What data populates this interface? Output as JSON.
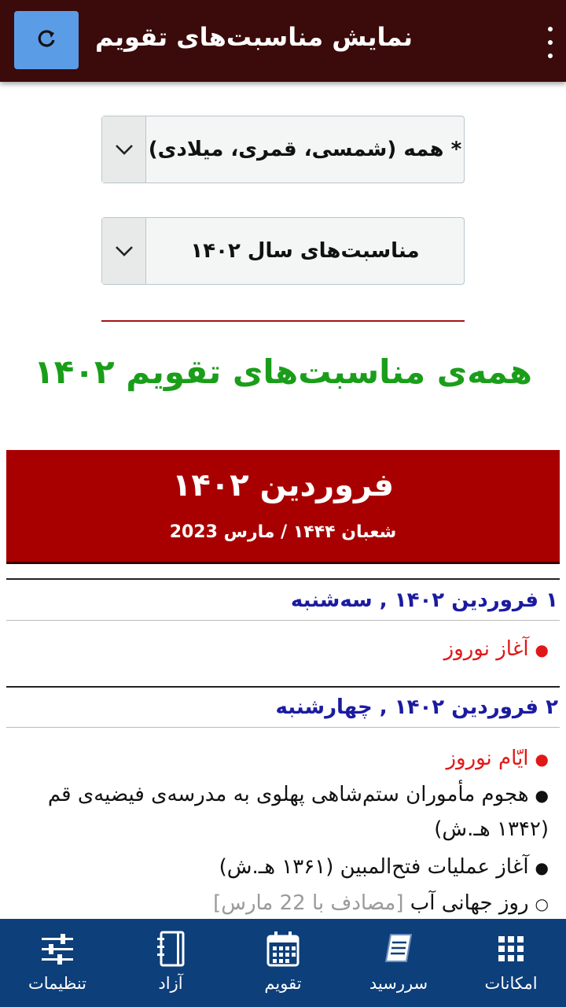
{
  "header": {
    "title": "نمایش مناسبت‌های تقویم",
    "refresh_icon": "refresh-icon",
    "menu_icon": "more-vert-icon"
  },
  "filters": {
    "calendar_type": "* همه (شمسی، قمری، میلادی)",
    "year_filter": "مناسبت‌های سال ۱۴۰۲"
  },
  "page_heading": "همه‌ی مناسبت‌های تقویم ۱۴۰۲",
  "month": {
    "title": "فروردین ۱۴۰۲",
    "subtitle": "شعبان ۱۴۴۴ / مارس 2023"
  },
  "days": [
    {
      "title": "۱ فروردین ۱۴۰۲ , سه‌شنبه",
      "events": [
        {
          "text": "آغاز نوروز",
          "bullet": "●"
        }
      ]
    },
    {
      "title": "۲ فروردین ۱۴۰۲ , چهارشنبه",
      "events": [
        {
          "text": "ایّام نوروز",
          "bullet": "●"
        },
        {
          "text": "هجوم مأموران ستم‌شاهی پهلوی به مدرسه‌ی فیضیه‌ی قم",
          "text2": "(۱۳۴۲ هـ.ش)",
          "bullet": "●"
        },
        {
          "text": "آغاز عملیات فتح‌المبین (۱۳۶۱ هـ.ش)",
          "bullet": "●"
        },
        {
          "text": "روز جهانی آب",
          "note": "[مصادف با 22 مارس]",
          "bullet": "○"
        }
      ]
    }
  ],
  "bottom_nav": [
    {
      "label": "امکانات",
      "icon": "grid-icon"
    },
    {
      "label": "سررسید",
      "icon": "book-icon"
    },
    {
      "label": "تقویم",
      "icon": "calendar-icon"
    },
    {
      "label": "آزاد",
      "icon": "notebook-icon"
    },
    {
      "label": "تنظیمات",
      "icon": "sliders-icon"
    }
  ],
  "colors": {
    "topbar": "#3b0a0a",
    "refresh_button": "#5b9ce6",
    "month_banner": "#a80000",
    "heading": "#1a9e1a",
    "day_title": "#1b1ba0",
    "holiday_event": "#e01818",
    "bottom_nav": "#0d3f7a"
  }
}
